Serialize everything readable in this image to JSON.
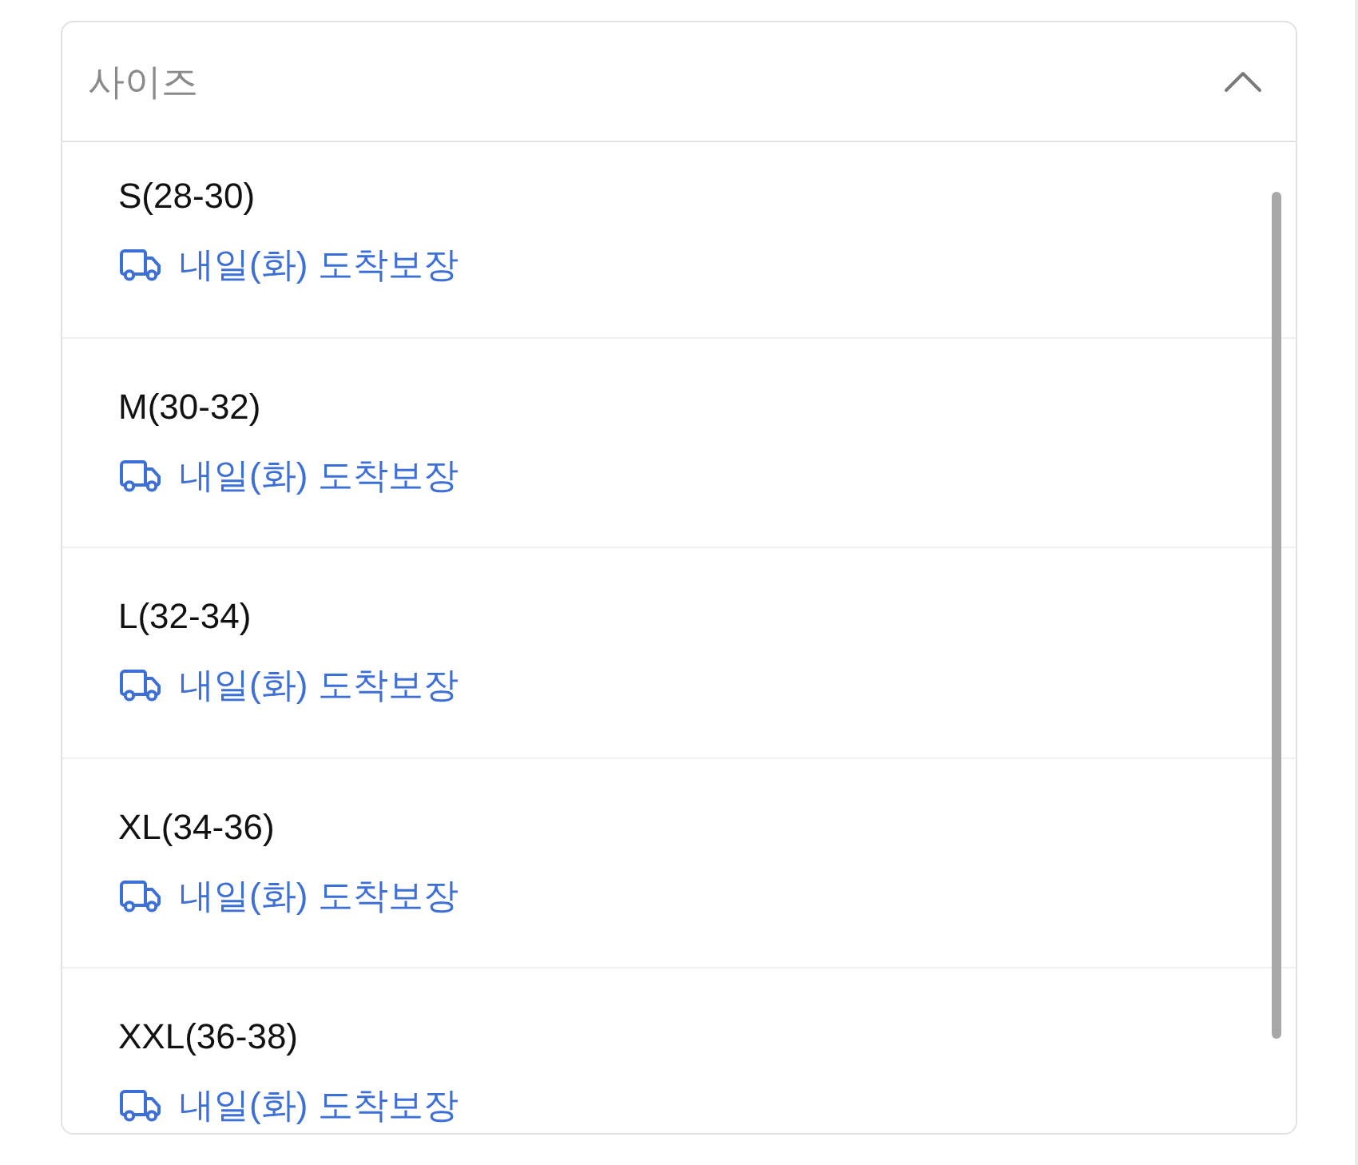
{
  "dropdown": {
    "placeholder": "사이즈",
    "expanded": true
  },
  "options": [
    {
      "label": "S(28-30)",
      "delivery": "내일(화) 도착보장",
      "selected": false
    },
    {
      "label": "M(30-32)",
      "delivery": "내일(화) 도착보장",
      "selected": false
    },
    {
      "label": "L(32-34)",
      "delivery": "내일(화) 도착보장",
      "selected": false
    },
    {
      "label": "XL(34-36)",
      "delivery": "내일(화) 도착보장",
      "selected": false
    },
    {
      "label": "XXL(36-38)",
      "delivery": "내일(화) 도착보장",
      "selected": false
    }
  ]
}
